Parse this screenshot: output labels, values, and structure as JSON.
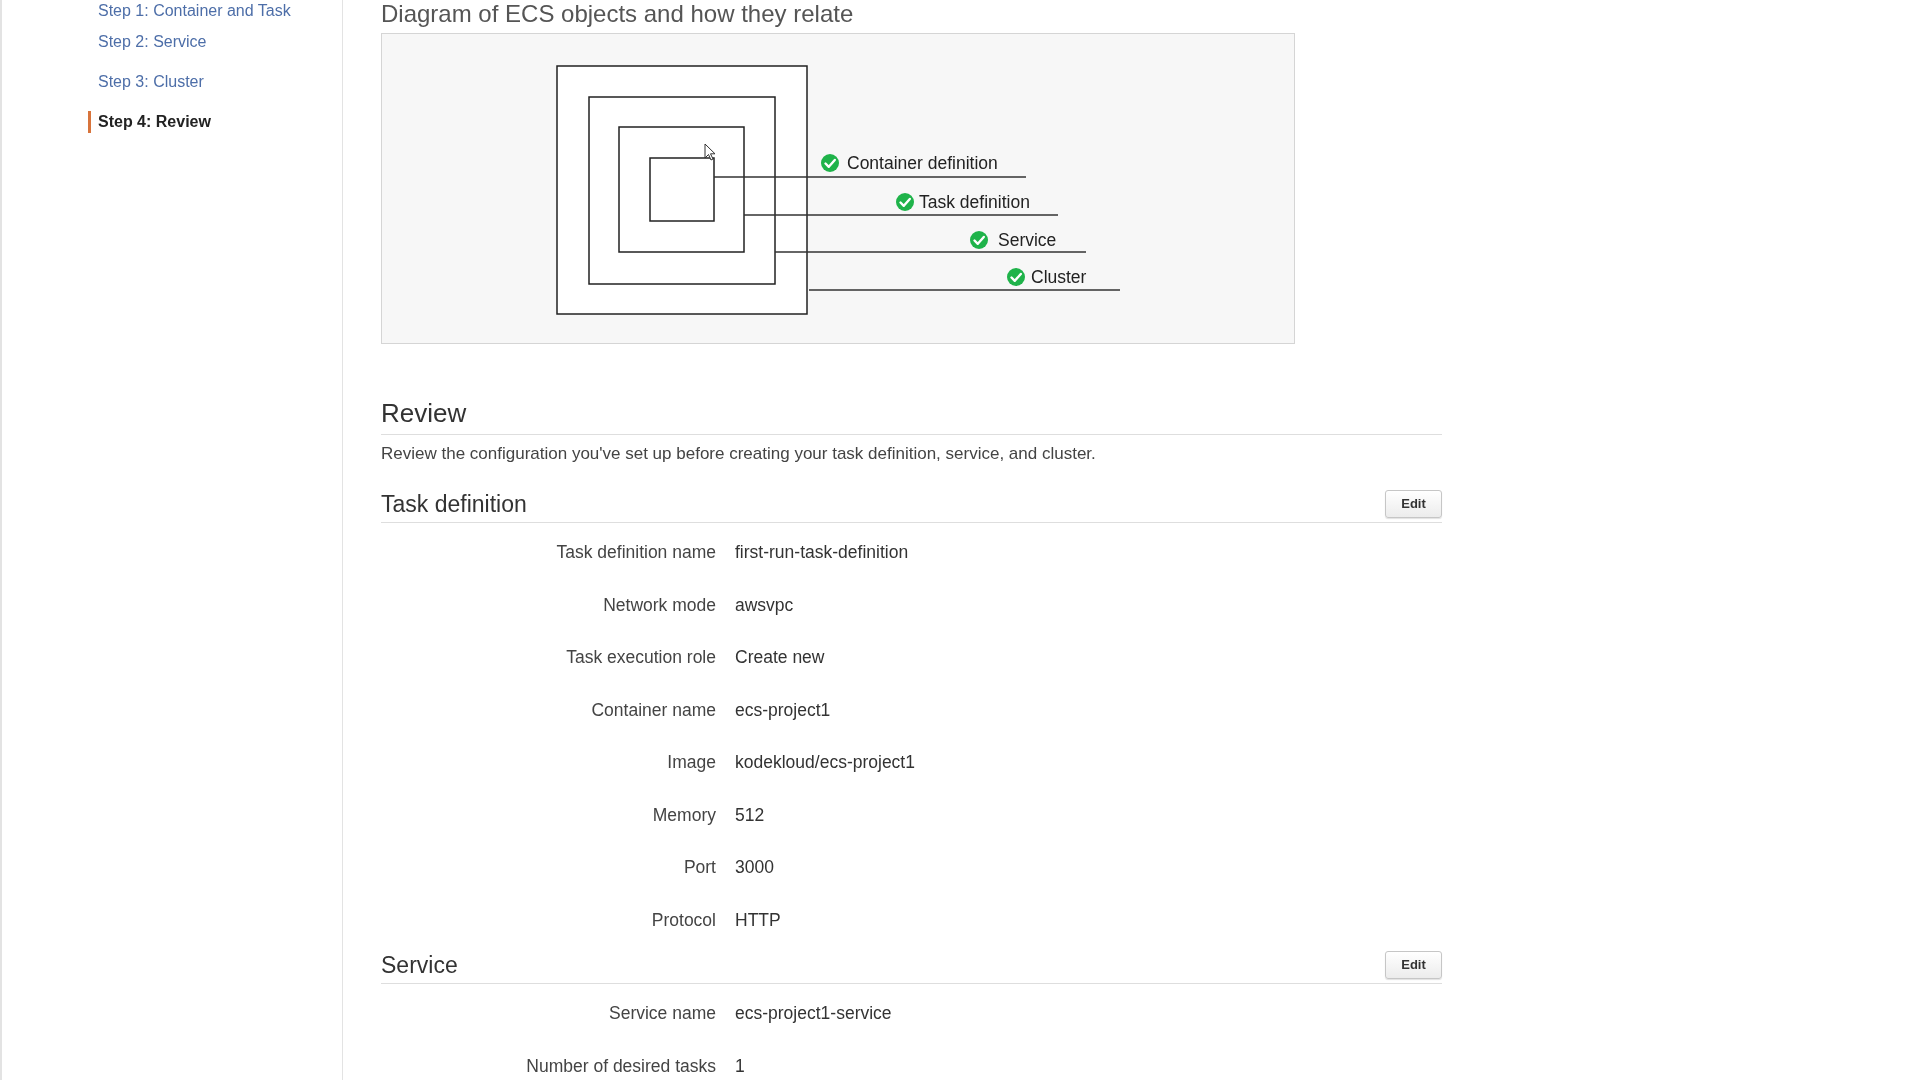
{
  "sidebar": {
    "steps": [
      {
        "label": "Step 1: Container and Task",
        "selected": false
      },
      {
        "label": "Step 2: Service",
        "selected": false
      },
      {
        "label": "Step 3: Cluster",
        "selected": false
      },
      {
        "label": "Step 4: Review",
        "selected": true
      }
    ]
  },
  "diagram": {
    "title": "Diagram of ECS objects and how they relate",
    "labels": [
      {
        "text": "Container definition",
        "checked": true
      },
      {
        "text": "Task definition",
        "checked": true
      },
      {
        "text": "Service",
        "checked": true
      },
      {
        "text": "Cluster",
        "checked": true
      }
    ]
  },
  "review": {
    "title": "Review",
    "description": "Review the configuration you've set up before creating your task definition, service, and cluster."
  },
  "sections": [
    {
      "title": "Task definition",
      "edit_button": "Edit",
      "fields": [
        {
          "label": "Task definition name",
          "value": "first-run-task-definition"
        },
        {
          "label": "Network mode",
          "value": "awsvpc"
        },
        {
          "label": "Task execution role",
          "value": "Create new"
        },
        {
          "label": "Container name",
          "value": "ecs-project1"
        },
        {
          "label": "Image",
          "value": "kodekloud/ecs-project1"
        },
        {
          "label": "Memory",
          "value": "512"
        },
        {
          "label": "Port",
          "value": "3000"
        },
        {
          "label": "Protocol",
          "value": "HTTP"
        }
      ]
    },
    {
      "title": "Service",
      "edit_button": "Edit",
      "fields": [
        {
          "label": "Service name",
          "value": "ecs-project1-service"
        },
        {
          "label": "Number of desired tasks",
          "value": "1"
        }
      ]
    }
  ]
}
